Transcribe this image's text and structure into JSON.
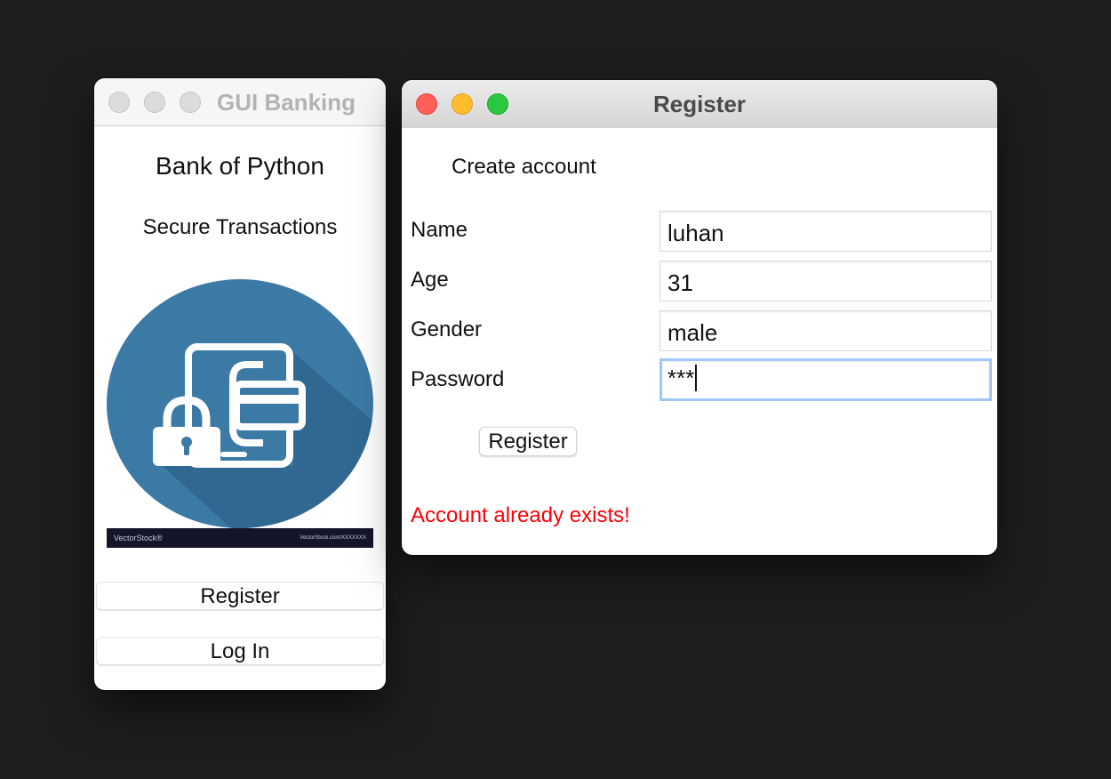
{
  "banking_window": {
    "title": "GUI Banking",
    "heading": "Bank of Python",
    "tagline": "Secure Transactions",
    "image_watermark": {
      "brand": "VectorStock®",
      "url_text": "VectorStock.com/XXXXXXX"
    },
    "register_button": "Register",
    "login_button": "Log In"
  },
  "register_window": {
    "title": "Register",
    "heading": "Create account",
    "fields": {
      "name": {
        "label": "Name",
        "value": "luhan"
      },
      "age": {
        "label": "Age",
        "value": "31"
      },
      "gender": {
        "label": "Gender",
        "value": "male"
      },
      "password": {
        "label": "Password",
        "value": "***"
      }
    },
    "submit_button": "Register",
    "error_message": "Account already exists!"
  },
  "colors": {
    "desktop_background": "#1e1e1e",
    "error_text": "#fb0007",
    "focus_ring": "#9fc7f3",
    "image_circle": "#3c7aa6",
    "traffic_close": "#ff5f57",
    "traffic_minimize": "#febc2e",
    "traffic_zoom": "#28c840"
  }
}
